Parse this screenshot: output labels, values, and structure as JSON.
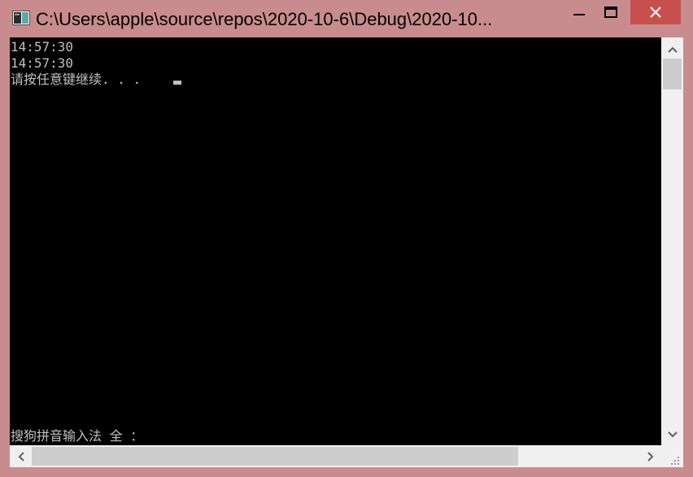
{
  "window": {
    "title": "C:\\Users\\apple\\source\\repos\\2020-10-6\\Debug\\2020-10...",
    "accent": "#c98c8e",
    "close_hover_color": "#c7504f"
  },
  "controls": {
    "minimize_icon": "minimize-icon",
    "maximize_icon": "maximize-icon",
    "close_icon": "close-icon"
  },
  "console": {
    "background": "#000000",
    "text_color": "#c0c0c0",
    "lines": [
      "14:57:30",
      "14:57:30",
      "请按任意键继续. . . "
    ],
    "ime_status": "搜狗拼音输入法 全 ："
  },
  "scrollbars": {
    "vertical": {
      "position": 0.0
    },
    "horizontal": {
      "position": 0.0
    }
  }
}
